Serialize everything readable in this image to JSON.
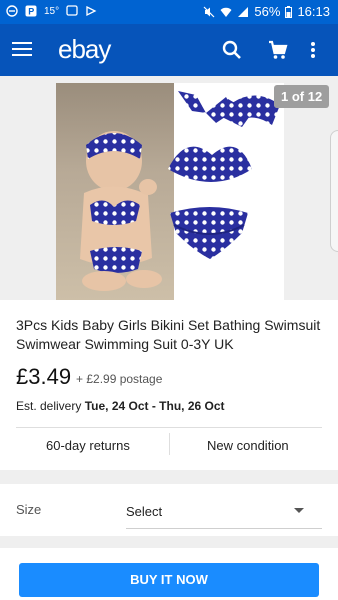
{
  "status_bar": {
    "temperature": "15°",
    "battery": "56%",
    "time": "16:13"
  },
  "app_bar": {
    "logo": "ebay"
  },
  "gallery": {
    "counter": "1 of 12"
  },
  "listing": {
    "title": "3Pcs Kids Baby Girls Bikini Set Bathing Swimsuit Swimwear Swimming Suit 0-3Y UK",
    "price": "£3.49",
    "postage": "+ £2.99 postage",
    "delivery_label": "Est. delivery",
    "delivery_dates": "Tue, 24 Oct - Thu, 26 Oct",
    "returns": "60-day returns",
    "condition": "New condition"
  },
  "size": {
    "label": "Size",
    "value": "Select"
  },
  "actions": {
    "buy_now": "BUY IT NOW"
  },
  "colors": {
    "status_bar": "#0063d1",
    "app_bar": "#0654ba",
    "buy_button": "#1a8cff",
    "swimsuit_blue": "#2a2fa0"
  }
}
